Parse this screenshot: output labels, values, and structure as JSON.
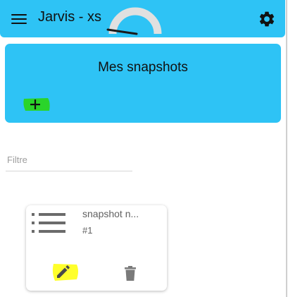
{
  "header": {
    "title": "Jarvis - xs",
    "menu_icon": "menu-icon",
    "settings_icon": "gear-icon",
    "accent_color": "#2ec3f5"
  },
  "snapshots_panel": {
    "title": "Mes snapshots",
    "add_icon": "plus-icon",
    "add_highlight_color": "#2ad42a"
  },
  "filter": {
    "placeholder": "Filtre",
    "value": ""
  },
  "snapshot_items": [
    {
      "name": "snapshot n...",
      "number": "#1",
      "edit_icon": "pencil-icon",
      "edit_highlight_color": "#ffff2b",
      "delete_icon": "trash-icon"
    }
  ]
}
